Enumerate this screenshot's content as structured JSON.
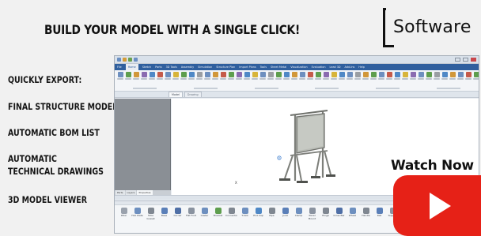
{
  "headline": "BUILD YOUR MODEL WITH A SINGLE CLICK!",
  "logo": {
    "letter": "L",
    "word": "Software"
  },
  "features": [
    "QUICKLY EXPORT:",
    "FINAL STRUCTURE MODEL",
    "AUTOMATIC BOM LIST",
    "AUTOMATIC TECHNICAL DRAWINGS",
    "3D MODEL VIEWER"
  ],
  "app": {
    "window_title": "",
    "menu_tabs": [
      "File",
      "Home",
      "Sketch",
      "Parts",
      "3D Tools",
      "Assembly",
      "Simulation",
      "Structure Plan",
      "Import Plans",
      "Tools",
      "Sheet Metal",
      "Visualization",
      "Evaluation",
      "Lead 3D",
      "Add-Ins",
      "Help"
    ],
    "selected_menu_tab": "Home",
    "document_tabs": [
      "Model",
      "Drawing"
    ],
    "panel_tabs": [
      "Parts",
      "Layers",
      "Properties"
    ],
    "axis_label": "X",
    "toolbox_items": [
      "Pillar",
      "Hub Plate",
      "Tube Gusset",
      "Base",
      "Corner",
      "Flat Foot",
      "Caster",
      "Bracket",
      "Connector",
      "T-Slot",
      "End Cap",
      "Pipe",
      "Joint",
      "Clamp",
      "Panel Mount",
      "Hinge",
      "Cross Bar",
      "Wheel",
      "Handle",
      "Rail",
      "Support",
      "Locking Wheel",
      "Rail Mount"
    ]
  },
  "watch_now": "Watch Now",
  "colors": {
    "background": "#f1f1f1",
    "menu_bar": "#2f5f9e",
    "left_panel": "#8a8f95",
    "play_button": "#e62117",
    "frame_steel": "#7d7f7a",
    "whiteboard": "#b9bcb6"
  },
  "icons": {
    "play": "youtube-play-icon",
    "logo_bracket": "l-bracket-logo",
    "model": "whiteboard-stand-model"
  }
}
